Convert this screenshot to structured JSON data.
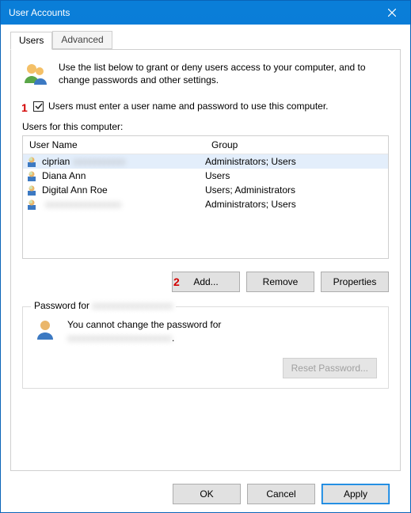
{
  "title": "User Accounts",
  "tabs": {
    "users": "Users",
    "advanced": "Advanced"
  },
  "intro": "Use the list below to grant or deny users access to your computer, and to change passwords and other settings.",
  "checkbox_label": "Users must enter a user name and password to use this computer.",
  "annotations": {
    "one": "1",
    "two": "2"
  },
  "userlist": {
    "label": "Users for this computer:",
    "columns": {
      "name": "User Name",
      "group": "Group"
    },
    "rows": [
      {
        "name": "ciprian",
        "name_blur": "xxxxxxxxxxx",
        "group": "Administrators; Users",
        "selected": true
      },
      {
        "name": "Diana Ann",
        "name_blur": "",
        "group": "Users",
        "selected": false
      },
      {
        "name": "Digital Ann Roe",
        "name_blur": "",
        "group": "Users; Administrators",
        "selected": false
      },
      {
        "name": "",
        "name_blur": "xxxxxxxxxxxxxxxx",
        "group": "Administrators; Users",
        "selected": false
      }
    ]
  },
  "buttons": {
    "add": "Add...",
    "remove": "Remove",
    "properties": "Properties"
  },
  "password_group": {
    "label_prefix": "Password for ",
    "label_blur": "xxxxxxxxxxxxxxxxx",
    "text_prefix": "You cannot change the password for",
    "text_blur": "xxxxxxxxxxxxxxxxxxxxxx",
    "text_suffix": ".",
    "reset": "Reset Password..."
  },
  "bottom": {
    "ok": "OK",
    "cancel": "Cancel",
    "apply": "Apply"
  }
}
